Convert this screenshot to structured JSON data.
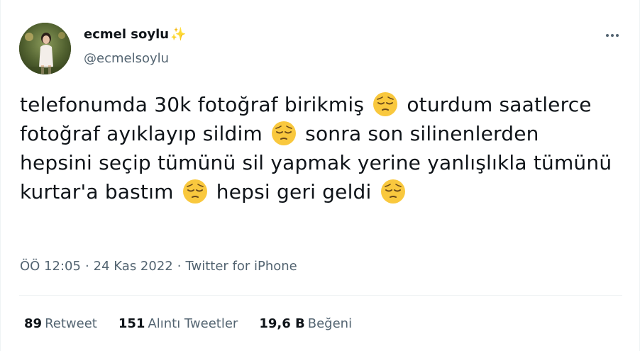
{
  "author": {
    "display_name": "ecmel soylu",
    "name_emoji": "✨",
    "handle": "@ecmelsoylu"
  },
  "tweet": {
    "segments": [
      {
        "type": "text",
        "value": "telefonumda 30k fotoğraf birikmiş "
      },
      {
        "type": "emoji",
        "icon": "pensive-face-emoji"
      },
      {
        "type": "text",
        "value": " oturdum saatlerce fotoğraf ayıklayıp sildim "
      },
      {
        "type": "emoji",
        "icon": "pensive-face-emoji"
      },
      {
        "type": "text",
        "value": " sonra son silinenlerden hepsini seçip tümünü sil yapmak yerine yanlışlıkla tümünü kurtar'a bastım "
      },
      {
        "type": "emoji",
        "icon": "pensive-face-emoji"
      },
      {
        "type": "text",
        "value": " hepsi geri geldi "
      },
      {
        "type": "emoji",
        "icon": "pensive-face-emoji"
      }
    ]
  },
  "meta": {
    "time": "ÖÖ 12:05",
    "sep1": "·",
    "date": "24 Kas 2022",
    "sep2": "·",
    "source": "Twitter for iPhone"
  },
  "stats": [
    {
      "count": "89",
      "label": "Retweet"
    },
    {
      "count": "151",
      "label": "Alıntı Tweetler"
    },
    {
      "count": "19,6 B",
      "label": "Beğeni"
    }
  ],
  "colors": {
    "text": "#0f1419",
    "secondary": "#536471",
    "divider": "#eff3f4",
    "emoji_face": "#f9c83e"
  }
}
